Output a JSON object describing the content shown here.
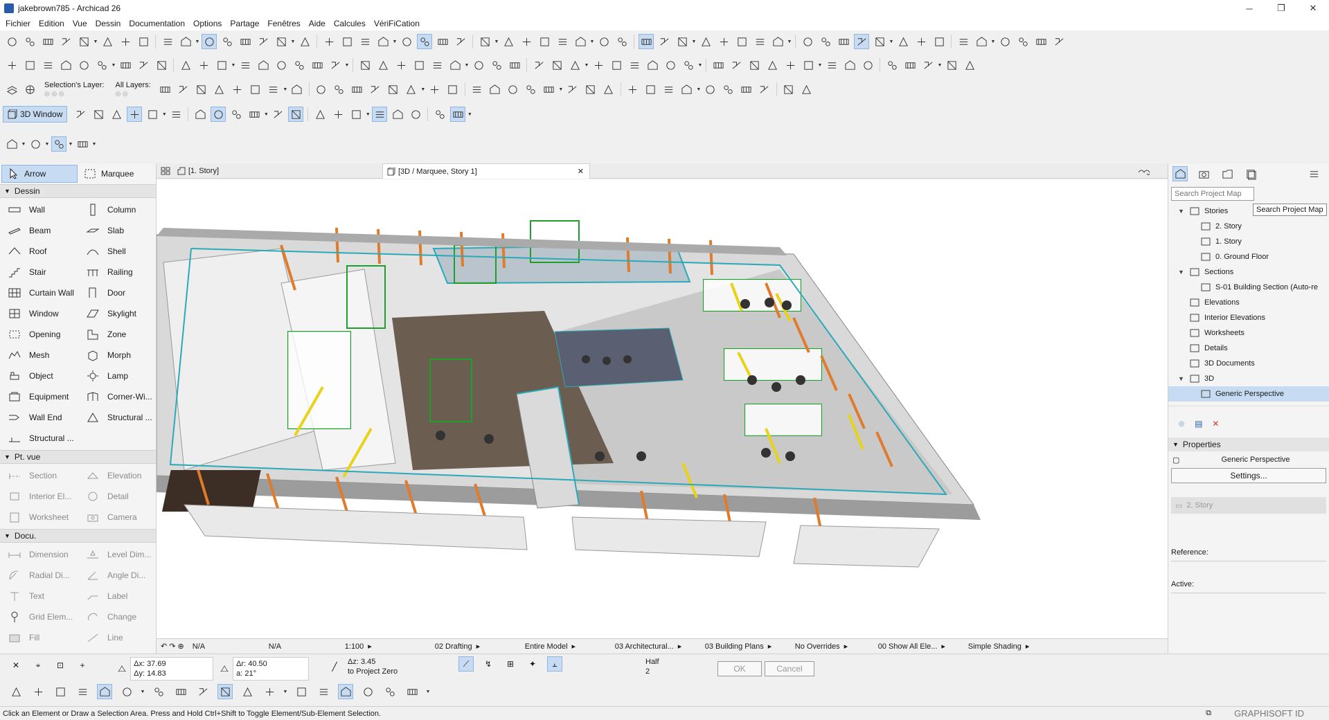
{
  "window": {
    "title": "jakebrown785 - Archicad 26",
    "minimize": "─",
    "maximize": "❐",
    "close": "✕"
  },
  "menubar": [
    "Fichier",
    "Edition",
    "Vue",
    "Dessin",
    "Documentation",
    "Options",
    "Partage",
    "Fenêtres",
    "Aide",
    "Calcules",
    "VériFiCation"
  ],
  "toolbar": {
    "selection_layer_label": "Selection's Layer:",
    "all_layers_label": "All Layers:",
    "view_3d_label": "3D Window"
  },
  "toolbox": {
    "arrow": "Arrow",
    "marquee": "Marquee",
    "groups": [
      {
        "name": "Dessin",
        "tools": [
          {
            "label": "Wall",
            "icon": "wall-icon"
          },
          {
            "label": "Column",
            "icon": "column-icon"
          },
          {
            "label": "Beam",
            "icon": "beam-icon"
          },
          {
            "label": "Slab",
            "icon": "slab-icon"
          },
          {
            "label": "Roof",
            "icon": "roof-icon"
          },
          {
            "label": "Shell",
            "icon": "shell-icon"
          },
          {
            "label": "Stair",
            "icon": "stair-icon"
          },
          {
            "label": "Railing",
            "icon": "railing-icon"
          },
          {
            "label": "Curtain Wall",
            "icon": "curtain-wall-icon"
          },
          {
            "label": "Door",
            "icon": "door-icon"
          },
          {
            "label": "Window",
            "icon": "window-icon"
          },
          {
            "label": "Skylight",
            "icon": "skylight-icon"
          },
          {
            "label": "Opening",
            "icon": "opening-icon"
          },
          {
            "label": "Zone",
            "icon": "zone-icon"
          },
          {
            "label": "Mesh",
            "icon": "mesh-icon"
          },
          {
            "label": "Morph",
            "icon": "morph-icon"
          },
          {
            "label": "Object",
            "icon": "object-icon"
          },
          {
            "label": "Lamp",
            "icon": "lamp-icon"
          },
          {
            "label": "Equipment",
            "icon": "equipment-icon"
          },
          {
            "label": "Corner-Wi...",
            "icon": "corner-window-icon"
          },
          {
            "label": "Wall End",
            "icon": "wall-end-icon"
          },
          {
            "label": "Structural ...",
            "icon": "structural-icon"
          },
          {
            "label": "Structural ...",
            "icon": "structural-support-icon"
          }
        ]
      },
      {
        "name": "Pt. vue",
        "tools": [
          {
            "label": "Section",
            "icon": "section-icon"
          },
          {
            "label": "Elevation",
            "icon": "elevation-icon"
          },
          {
            "label": "Interior El...",
            "icon": "interior-elevation-icon"
          },
          {
            "label": "Detail",
            "icon": "detail-icon"
          },
          {
            "label": "Worksheet",
            "icon": "worksheet-icon"
          },
          {
            "label": "Camera",
            "icon": "camera-icon"
          }
        ]
      },
      {
        "name": "Docu.",
        "tools": [
          {
            "label": "Dimension",
            "icon": "dimension-icon"
          },
          {
            "label": "Level Dim...",
            "icon": "level-dimension-icon"
          },
          {
            "label": "Radial Di...",
            "icon": "radial-dimension-icon"
          },
          {
            "label": "Angle Di...",
            "icon": "angle-dimension-icon"
          },
          {
            "label": "Text",
            "icon": "text-icon"
          },
          {
            "label": "Label",
            "icon": "label-icon"
          },
          {
            "label": "Grid Elem...",
            "icon": "grid-element-icon"
          },
          {
            "label": "Change",
            "icon": "change-icon"
          },
          {
            "label": "Fill",
            "icon": "fill-icon"
          },
          {
            "label": "Line",
            "icon": "line-icon"
          }
        ]
      }
    ]
  },
  "tabs": [
    {
      "label": "[1. Story]",
      "active": false
    },
    {
      "label": "[3D / Marquee, Story 1]",
      "active": true,
      "close": "✕"
    }
  ],
  "viewport_status": {
    "na1": "N/A",
    "na2": "N/A",
    "scale": "1:100",
    "layer_combo": "02 Drafting",
    "model": "Entire Model",
    "pen_set": "03 Architectural...",
    "mvo": "03 Building Plans",
    "overrides": "No Overrides",
    "renovation": "00 Show All Ele...",
    "shading": "Simple Shading"
  },
  "navigator": {
    "search_placeholder": "Search Project Map",
    "tooltip": "Search Project Map",
    "tree": [
      {
        "label": "Stories",
        "level": 1,
        "caret": "▼"
      },
      {
        "label": "2. Story",
        "level": 2,
        "caret": ""
      },
      {
        "label": "1. Story",
        "level": 2,
        "caret": ""
      },
      {
        "label": "0. Ground Floor",
        "level": 2,
        "caret": ""
      },
      {
        "label": "Sections",
        "level": 1,
        "caret": "▼"
      },
      {
        "label": "S-01 Building Section (Auto-re",
        "level": 2,
        "caret": ""
      },
      {
        "label": "Elevations",
        "level": 1,
        "caret": ""
      },
      {
        "label": "Interior Elevations",
        "level": 1,
        "caret": ""
      },
      {
        "label": "Worksheets",
        "level": 1,
        "caret": ""
      },
      {
        "label": "Details",
        "level": 1,
        "caret": ""
      },
      {
        "label": "3D Documents",
        "level": 1,
        "caret": ""
      },
      {
        "label": "3D",
        "level": 1,
        "caret": "▼"
      },
      {
        "label": "Generic Perspective",
        "level": 2,
        "caret": "",
        "selected": true
      }
    ],
    "properties_header": "Properties",
    "properties_name": "Generic Perspective",
    "settings_button": "Settings...",
    "story_field": "2. Story",
    "reference_label": "Reference:",
    "active_label": "Active:"
  },
  "infobox": {
    "dx": "Δx: 37.69",
    "dy": "Δy: 14.83",
    "dr": "Δr: 40.50",
    "angle": "a: 21°",
    "dz": "Δz: 3.45",
    "to_project_zero": "to Project Zero",
    "half": "Half",
    "half_val": "2",
    "ok": "OK",
    "cancel": "Cancel"
  },
  "status": {
    "message": "Click an Element or Draw a Selection Area. Press and Hold Ctrl+Shift to Toggle Element/Sub-Element Selection.",
    "brand": "GRAPHISOFT ID"
  },
  "colors": {
    "accent": "#c7dcf3",
    "selection_green": "#1f9e2a",
    "facade_orange": "#e07b2c",
    "wall_cyan": "#2aa9b8"
  }
}
